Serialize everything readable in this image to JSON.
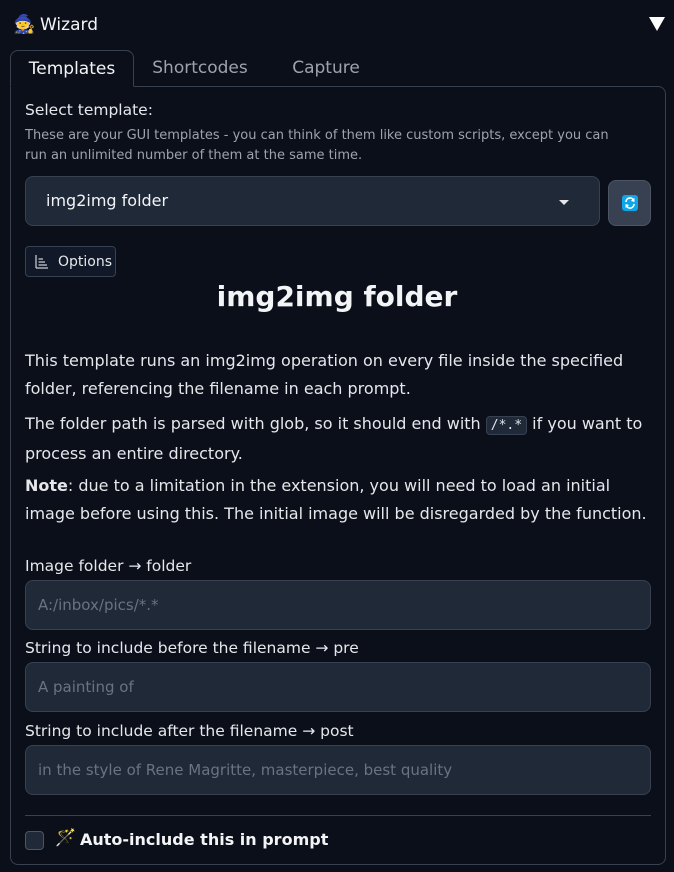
{
  "header": {
    "title": "Wizard",
    "icon": "wizard-icon",
    "collapse_icon": "triangle-down-icon"
  },
  "tabs": [
    {
      "label": "Templates",
      "active": true
    },
    {
      "label": "Shortcodes",
      "active": false
    },
    {
      "label": "Capture",
      "active": false
    }
  ],
  "template": {
    "label": "Select template:",
    "description": "These are your GUI templates - you can think of them like custom scripts, except you can run an unlimited number of them at the same time.",
    "selected": "img2img folder",
    "refresh_icon": "refresh-icon"
  },
  "options": {
    "label": "Options",
    "icon": "options-icon"
  },
  "content": {
    "heading": "img2img folder",
    "para1": "This template runs an img2img operation on every file inside the specified folder, referencing the filename in each prompt.",
    "para2_pre": "The folder path is parsed with glob, so it should end with ",
    "para2_code": "/*.*",
    "para2_post": " if you want to process an entire directory.",
    "note_label": "Note",
    "note_text": ": due to a limitation in the extension, you will need to load an initial image before using this. The initial image will be disregarded by the function."
  },
  "fields": [
    {
      "label": "Image folder → folder",
      "placeholder": "A:/inbox/pics/*.*",
      "value": ""
    },
    {
      "label": "String to include before the filename → pre",
      "placeholder": "A painting of",
      "value": ""
    },
    {
      "label": "String to include after the filename → post",
      "placeholder": "in the style of Rene Magritte, masterpiece, best quality",
      "value": ""
    }
  ],
  "auto_include": {
    "label": "Auto-include this in prompt",
    "checked": false,
    "icon": "magic-wand-icon"
  },
  "colors": {
    "background": "#0b0f19",
    "panel_border": "#374151",
    "input_bg": "#1f2937",
    "accent": "#0ea5e9"
  }
}
